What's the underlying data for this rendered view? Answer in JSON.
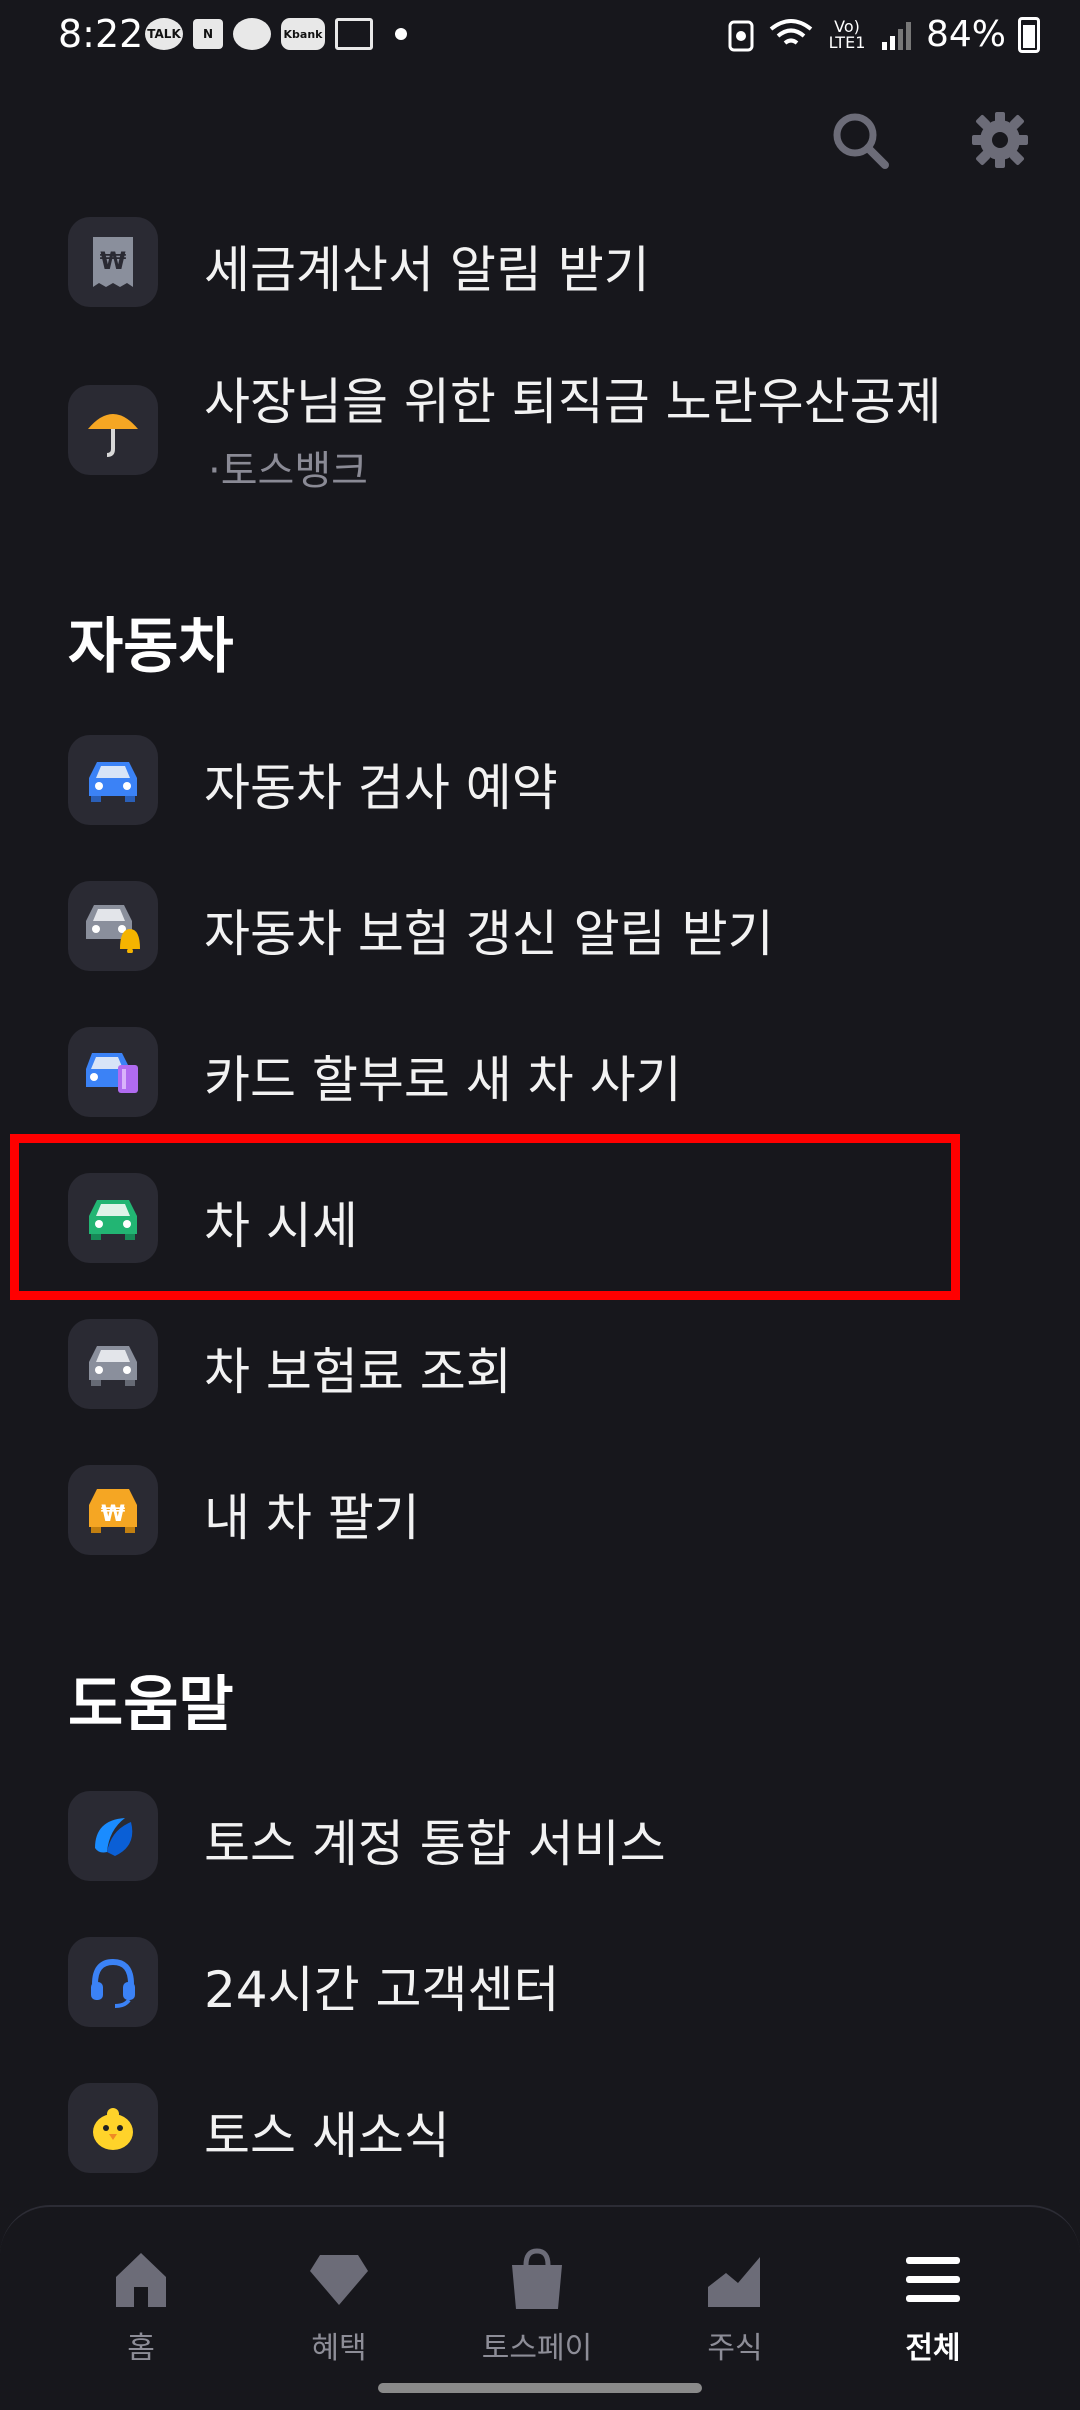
{
  "status": {
    "time": "8:22",
    "apps": [
      "TALK",
      "N",
      "",
      "Kbank",
      ""
    ],
    "network": "Vo) LTE1",
    "battery": "84%"
  },
  "header": {
    "search_icon": "search-icon",
    "settings_icon": "gear-icon"
  },
  "items_top": [
    {
      "label": "세금계산서 알림 받기",
      "icon": "won-receipt-icon"
    },
    {
      "label": "사장님을 위한 퇴직금 노란우산공제",
      "sub": "·토스뱅크",
      "icon": "umbrella-icon"
    }
  ],
  "sections": [
    {
      "title": "자동차",
      "items": [
        {
          "label": "자동차 검사 예약",
          "icon": "blue-car-icon"
        },
        {
          "label": "자동차 보험 갱신 알림 받기",
          "icon": "car-bell-icon"
        },
        {
          "label": "카드 할부로 새 차 사기",
          "icon": "car-card-icon"
        },
        {
          "label": "차 시세",
          "icon": "green-car-icon"
        },
        {
          "label": "차 보험료 조회",
          "icon": "gray-car-icon"
        },
        {
          "label": "내 차 팔기",
          "icon": "won-car-icon"
        }
      ]
    },
    {
      "title": "도움말",
      "items": [
        {
          "label": "토스 계정 통합 서비스",
          "icon": "toss-logo-icon"
        },
        {
          "label": "24시간 고객센터",
          "icon": "headset-icon"
        },
        {
          "label": "토스 새소식",
          "icon": "chick-icon"
        }
      ]
    }
  ],
  "nav": [
    {
      "label": "홈",
      "icon": "home-icon"
    },
    {
      "label": "혜택",
      "icon": "diamond-icon"
    },
    {
      "label": "토스페이",
      "icon": "bag-icon"
    },
    {
      "label": "주식",
      "icon": "chart-icon"
    },
    {
      "label": "전체",
      "icon": "menu-icon",
      "active": true
    }
  ]
}
